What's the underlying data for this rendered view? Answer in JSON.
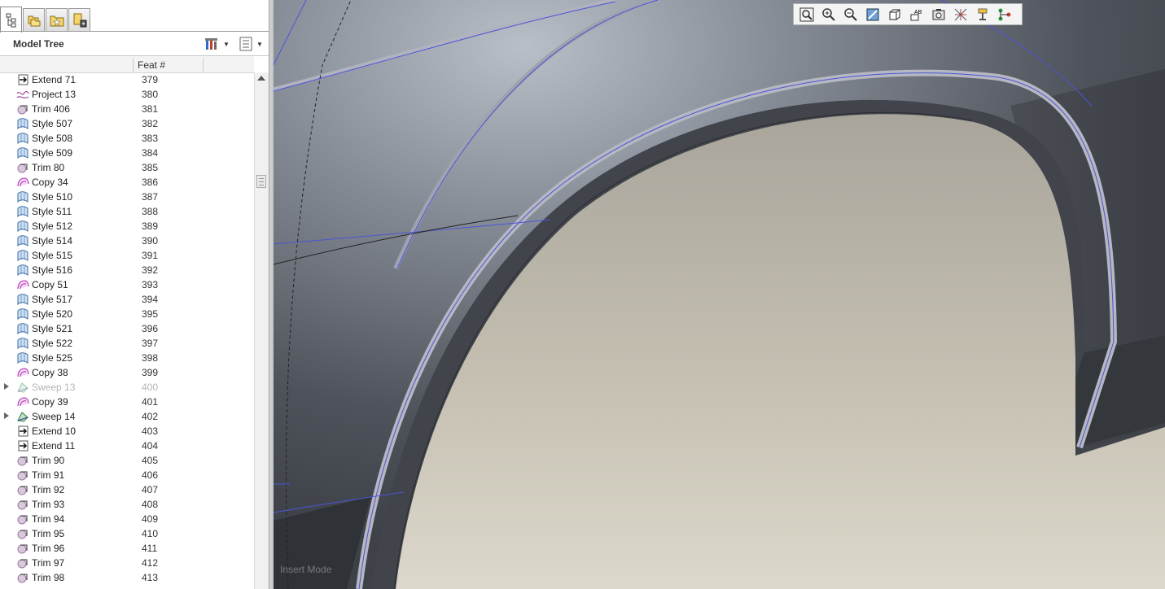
{
  "panel": {
    "tabs": [
      {
        "name": "model-tree-tab-icon",
        "active": true
      },
      {
        "name": "folder-browser-tab-icon",
        "active": false
      },
      {
        "name": "favorites-tab-icon",
        "active": false
      },
      {
        "name": "layers-tab-icon",
        "active": false
      }
    ],
    "title": "Model Tree",
    "column_header": "Feat #"
  },
  "tree_rows": [
    {
      "icon": "extend",
      "name": "Extend 71",
      "feat": "379"
    },
    {
      "icon": "project",
      "name": "Project 13",
      "feat": "380"
    },
    {
      "icon": "trim",
      "name": "Trim 406",
      "feat": "381"
    },
    {
      "icon": "style",
      "name": "Style 507",
      "feat": "382"
    },
    {
      "icon": "style",
      "name": "Style 508",
      "feat": "383"
    },
    {
      "icon": "style",
      "name": "Style 509",
      "feat": "384"
    },
    {
      "icon": "trim",
      "name": "Trim 80",
      "feat": "385"
    },
    {
      "icon": "copy",
      "name": "Copy 34",
      "feat": "386"
    },
    {
      "icon": "style",
      "name": "Style 510",
      "feat": "387"
    },
    {
      "icon": "style",
      "name": "Style 511",
      "feat": "388"
    },
    {
      "icon": "style",
      "name": "Style 512",
      "feat": "389"
    },
    {
      "icon": "style",
      "name": "Style 514",
      "feat": "390"
    },
    {
      "icon": "style",
      "name": "Style 515",
      "feat": "391"
    },
    {
      "icon": "style",
      "name": "Style 516",
      "feat": "392"
    },
    {
      "icon": "copy",
      "name": "Copy 51",
      "feat": "393"
    },
    {
      "icon": "style",
      "name": "Style 517",
      "feat": "394"
    },
    {
      "icon": "style",
      "name": "Style 520",
      "feat": "395"
    },
    {
      "icon": "style",
      "name": "Style 521",
      "feat": "396"
    },
    {
      "icon": "style",
      "name": "Style 522",
      "feat": "397"
    },
    {
      "icon": "style",
      "name": "Style 525",
      "feat": "398"
    },
    {
      "icon": "copy",
      "name": "Copy 38",
      "feat": "399"
    },
    {
      "icon": "sweep",
      "name": "Sweep 13",
      "feat": "400",
      "expandable": true,
      "dimmed": true
    },
    {
      "icon": "copy",
      "name": "Copy 39",
      "feat": "401"
    },
    {
      "icon": "sweep",
      "name": "Sweep 14",
      "feat": "402",
      "expandable": true
    },
    {
      "icon": "extend",
      "name": "Extend 10",
      "feat": "403"
    },
    {
      "icon": "extend",
      "name": "Extend 11",
      "feat": "404"
    },
    {
      "icon": "trim",
      "name": "Trim 90",
      "feat": "405"
    },
    {
      "icon": "trim",
      "name": "Trim 91",
      "feat": "406"
    },
    {
      "icon": "trim",
      "name": "Trim 92",
      "feat": "407"
    },
    {
      "icon": "trim",
      "name": "Trim 93",
      "feat": "408"
    },
    {
      "icon": "trim",
      "name": "Trim 94",
      "feat": "409"
    },
    {
      "icon": "trim",
      "name": "Trim 95",
      "feat": "410"
    },
    {
      "icon": "trim",
      "name": "Trim 96",
      "feat": "411"
    },
    {
      "icon": "trim",
      "name": "Trim 97",
      "feat": "412"
    },
    {
      "icon": "trim",
      "name": "Trim 98",
      "feat": "413"
    }
  ],
  "view_toolbar": [
    "refit-icon",
    "zoom-in-icon",
    "zoom-out-icon",
    "repaint-icon",
    "saved-views-icon",
    "annotation-display-icon",
    "named-views-icon",
    "datum-display-icon",
    "spin-center-icon",
    "selection-filter-icon"
  ],
  "viewport": {
    "mode_text": "Insert Mode"
  },
  "colors": {
    "accent_blue": "#3d4be0",
    "surface_dark": "#4b4f58",
    "background_beige": "#c9c5b7"
  }
}
